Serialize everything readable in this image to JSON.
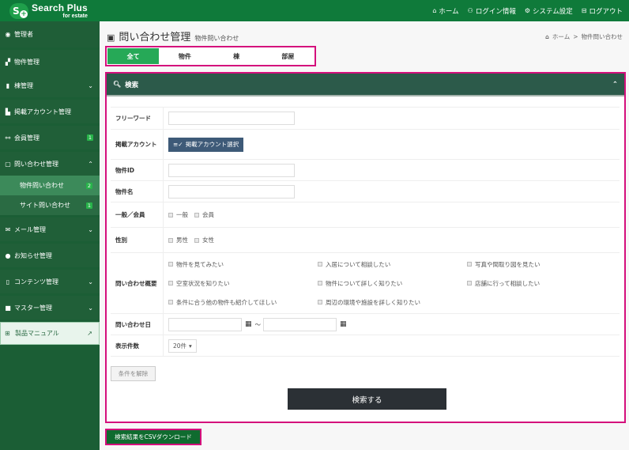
{
  "header": {
    "logo_title": "Search Plus",
    "logo_sub": "for estate",
    "logo_mark": "S",
    "nav": [
      {
        "icon": "home-icon",
        "glyph": "⌂",
        "label": "ホーム"
      },
      {
        "icon": "user-icon",
        "glyph": "👤",
        "label": "ログイン情報"
      },
      {
        "icon": "gear-icon",
        "glyph": "⚙",
        "label": "システム設定"
      },
      {
        "icon": "logout-icon",
        "glyph": "⇥",
        "label": "ログアウト"
      }
    ]
  },
  "sidebar": {
    "user": {
      "glyph": "●",
      "label": "管理者"
    },
    "items": [
      {
        "label": "物件管理",
        "glyph": "▞"
      },
      {
        "label": "棟管理",
        "glyph": "▮",
        "chevron": "⌄"
      },
      {
        "label": "掲載アカウント管理",
        "glyph": "▙"
      },
      {
        "label": "会員管理",
        "glyph": "👥",
        "badge": "1"
      },
      {
        "label": "問い合わせ管理",
        "glyph": "▢",
        "chevron": "⌃"
      },
      {
        "label": "メール管理",
        "glyph": "✉",
        "chevron": "⌄"
      },
      {
        "label": "お知らせ管理",
        "glyph": "●"
      },
      {
        "label": "コンテンツ管理",
        "glyph": "▯",
        "chevron": "⌄"
      },
      {
        "label": "マスター管理",
        "glyph": "■",
        "chevron": "⌄"
      }
    ],
    "sub_items": [
      {
        "label": "物件問い合わせ",
        "badge": "2"
      },
      {
        "label": "サイト問い合わせ",
        "badge": "1"
      }
    ],
    "manual": {
      "label": "製品マニュアル",
      "glyph": "🕮",
      "ext": "↗"
    }
  },
  "page": {
    "title": "問い合わせ管理",
    "subtitle": "物件問い合わせ",
    "breadcrumb": {
      "home": "ホーム",
      "sep": ">",
      "current": "物件問い合わせ"
    }
  },
  "tabs": [
    {
      "label": "全て",
      "active": true
    },
    {
      "label": "物件"
    },
    {
      "label": "棟"
    },
    {
      "label": "部屋"
    }
  ],
  "search": {
    "title": "検索",
    "fields": {
      "freeword": {
        "label": "フリーワード",
        "value": ""
      },
      "account": {
        "label": "掲載アカウント",
        "button": "掲載アカウント選択"
      },
      "property_id": {
        "label": "物件ID",
        "value": ""
      },
      "property_name": {
        "label": "物件名",
        "value": ""
      },
      "member": {
        "label": "一般／会員",
        "options": [
          "一般",
          "会員"
        ]
      },
      "gender": {
        "label": "性別",
        "options": [
          "男性",
          "女性"
        ]
      },
      "summary": {
        "label": "問い合わせ概要",
        "options": [
          "物件を見てみたい",
          "入居について相談したい",
          "写真や間取り図を見たい",
          "空室状況を知りたい",
          "物件について詳しく知りたい",
          "店舗に行って相談したい",
          "条件に合う他の物件も紹介してほしい",
          "周辺の環境や施設を詳しく知りたい"
        ]
      },
      "date": {
        "label": "問い合わせ日",
        "from": "",
        "to": "",
        "sep": "～"
      },
      "per_page": {
        "label": "表示件数",
        "value": "20件"
      }
    },
    "clear_button": "条件を解除",
    "submit_button": "検索する"
  },
  "csv_button": "検索結果をCSVダウンロード",
  "colors": {
    "header_bg": "#0f7a3a",
    "sidebar_bg": "#1b5e35",
    "accent_green": "#26a957",
    "search_header": "#2c5a4a",
    "highlight_border": "#d40f7c",
    "submit_bg": "#2b3035"
  }
}
